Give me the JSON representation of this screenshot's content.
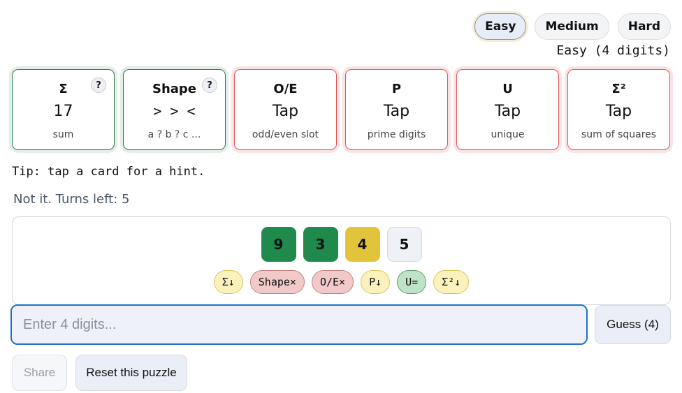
{
  "difficulty": {
    "options": [
      "Easy",
      "Medium",
      "Hard"
    ],
    "selected": "Easy",
    "mode_label": "Easy (4 digits)"
  },
  "cards": [
    {
      "title": "Σ",
      "value": "17",
      "desc": "sum",
      "solved": true,
      "has_help": true,
      "help": "?"
    },
    {
      "title": "Shape",
      "value": "> > <",
      "desc": "a ? b ? c ...",
      "solved": true,
      "has_help": true,
      "help": "?"
    },
    {
      "title": "O/E",
      "value": "Tap",
      "desc": "odd/even slot",
      "solved": false
    },
    {
      "title": "P",
      "value": "Tap",
      "desc": "prime digits",
      "solved": false
    },
    {
      "title": "U",
      "value": "Tap",
      "desc": "unique",
      "solved": false
    },
    {
      "title": "Σ²",
      "value": "Tap",
      "desc": "sum of squares",
      "solved": false
    }
  ],
  "tip": "Tip: tap a card for a hint.",
  "status": "Not it. Turns left: 5",
  "last_guess": {
    "tiles": [
      {
        "digit": "9",
        "state": "green"
      },
      {
        "digit": "3",
        "state": "green"
      },
      {
        "digit": "4",
        "state": "yellow"
      },
      {
        "digit": "5",
        "state": "gray"
      }
    ],
    "chips": [
      {
        "label": "Σ↓",
        "kind": "down"
      },
      {
        "label": "Shape×",
        "kind": "miss"
      },
      {
        "label": "O/E×",
        "kind": "miss"
      },
      {
        "label": "P↓",
        "kind": "down"
      },
      {
        "label": "U=",
        "kind": "eq"
      },
      {
        "label": "Σ²↓",
        "kind": "down"
      }
    ]
  },
  "input": {
    "value": "",
    "placeholder": "Enter 4 digits..."
  },
  "buttons": {
    "guess": "Guess (4)",
    "share": "Share",
    "reset": "Reset this puzzle"
  },
  "colors": {
    "tile_green": "#1f8a4b",
    "tile_yellow": "#e2c43a",
    "card_solved_border": "#2e7d4f",
    "card_pending_border": "#e05656",
    "input_focus": "#1f6fd1"
  }
}
